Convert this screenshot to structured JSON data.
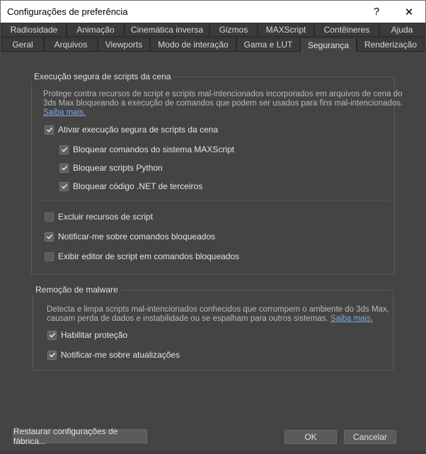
{
  "window": {
    "title": "Configurações de preferência",
    "help_label": "?",
    "close_label": "✕"
  },
  "tabs_row1": [
    {
      "label": "Radiosidade"
    },
    {
      "label": "Animação"
    },
    {
      "label": "Cinemática inversa"
    },
    {
      "label": "Gizmos"
    },
    {
      "label": "MAXScript"
    },
    {
      "label": "Contêineres"
    },
    {
      "label": "Ajuda"
    }
  ],
  "tabs_row2": [
    {
      "label": "Geral"
    },
    {
      "label": "Arquivos"
    },
    {
      "label": "Viewports"
    },
    {
      "label": "Modo de interação"
    },
    {
      "label": "Gama e LUT"
    },
    {
      "label": "Segurança",
      "active": true
    },
    {
      "label": "Renderização"
    }
  ],
  "safe_execution": {
    "title": "Execução segura de scripts da cena",
    "description_line1": "Protege contra recursos de script e scripts mal-intencionados incorporados em arquivos de cena do",
    "description_line2": "3ds Max bloqueando a execução de comandos que podem ser usados para fins mal-intencionados.",
    "learn_more": "Saiba mais.",
    "enable": {
      "label": "Ativar execução segura de scripts da cena",
      "checked": true
    },
    "block_maxscript": {
      "label": "Bloquear comandos do sistema MAXScript",
      "checked": true
    },
    "block_python": {
      "label": "Bloquear scripts Python",
      "checked": true
    },
    "block_dotnet": {
      "label": "Bloquear código .NET de terceiros",
      "checked": true
    },
    "exclude_resources": {
      "label": "Excluir recursos de script",
      "checked": false
    },
    "notify_blocked": {
      "label": "Notificar-me sobre comandos bloqueados",
      "checked": true
    },
    "show_editor": {
      "label": "Exibir editor de script em comandos bloqueados",
      "checked": false
    }
  },
  "malware_removal": {
    "title": "Remoção de malware",
    "description_line1": "Detecta e limpa scripts mal-intencionados conhecidos que corrompem o ambiente do 3ds Max,",
    "description_line2": "causam perda de dados e instabilidade ou se espalham para outros sistemas.",
    "learn_more": "Saiba mais.",
    "enable_protection": {
      "label": "Habilitar proteção",
      "checked": true
    },
    "notify_updates": {
      "label": "Notificar-me sobre atualizações",
      "checked": true
    }
  },
  "buttons": {
    "restore": "Restaurar configurações de fábrica...",
    "ok": "OK",
    "cancel": "Cancelar"
  }
}
